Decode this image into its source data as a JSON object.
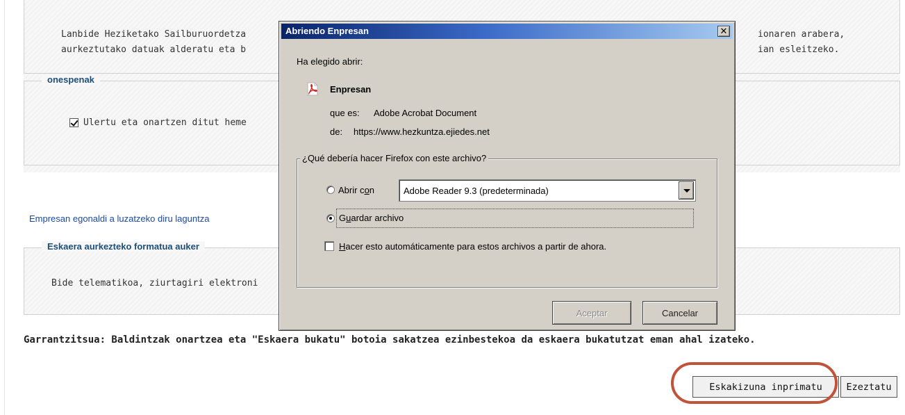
{
  "background_page": {
    "intro_text": {
      "line1_left": "Lanbide Heziketako Sailburuordetza",
      "line1_right": "ionaren arabera,",
      "line2_left": "aurkeztutako datuak alderatu eta b",
      "line2_right": "ian esleitzeko."
    },
    "onespenak": {
      "legend": "onespenak",
      "checkbox_checked": true,
      "checkbox_label": "Ulertu eta onartzen ditut heme"
    },
    "link_text": "Empresan egonaldi a luzatzeko diru laguntza",
    "format": {
      "legend": "Eskaera aurkezteko formatua auker",
      "text": "Bide telematikoa, ziurtagiri elektroni"
    },
    "important_text": "Garrantzitsua: Baldintzak onartzea eta \"Eskaera bukatu\" botoia sakatzea ezinbestekoa da eskaera bukatutzat eman ahal izateko.",
    "buttons": {
      "print": "Eskakizuna inprimatu",
      "cancel": "Ezeztatu"
    },
    "highlight_color": "#c0533a"
  },
  "dialog": {
    "title": "Abriendo Enpresan",
    "close_label": "✕",
    "chosen_open_label": "Ha elegido abrir:",
    "file_icon": "pdf-icon",
    "file_name": "Enpresan",
    "type_label": "que es:",
    "type_value": "Adobe Acrobat Document",
    "from_label": "de:",
    "from_value": "https://www.hezkuntza.ejiedes.net",
    "question": "¿Qué debería hacer Firefox con este archivo?",
    "open_with": {
      "label_pre": "Abrir c",
      "label_u": "o",
      "label_post": "n",
      "selected": false,
      "app": "Adobe Reader 9.3 (predeterminada)"
    },
    "save_file": {
      "label_pre": "G",
      "label_u": "u",
      "label_post": "ardar archivo",
      "selected": true
    },
    "auto": {
      "label_pre": "",
      "label_u": "H",
      "label_post": "acer esto automáticamente para estos archivos a partir de ahora.",
      "checked": false
    },
    "ok_label": "Aceptar",
    "cancel_label": "Cancelar",
    "colors": {
      "title_start": "#0a246a",
      "title_end": "#a6caf0",
      "face": "#d4d0c8"
    }
  }
}
